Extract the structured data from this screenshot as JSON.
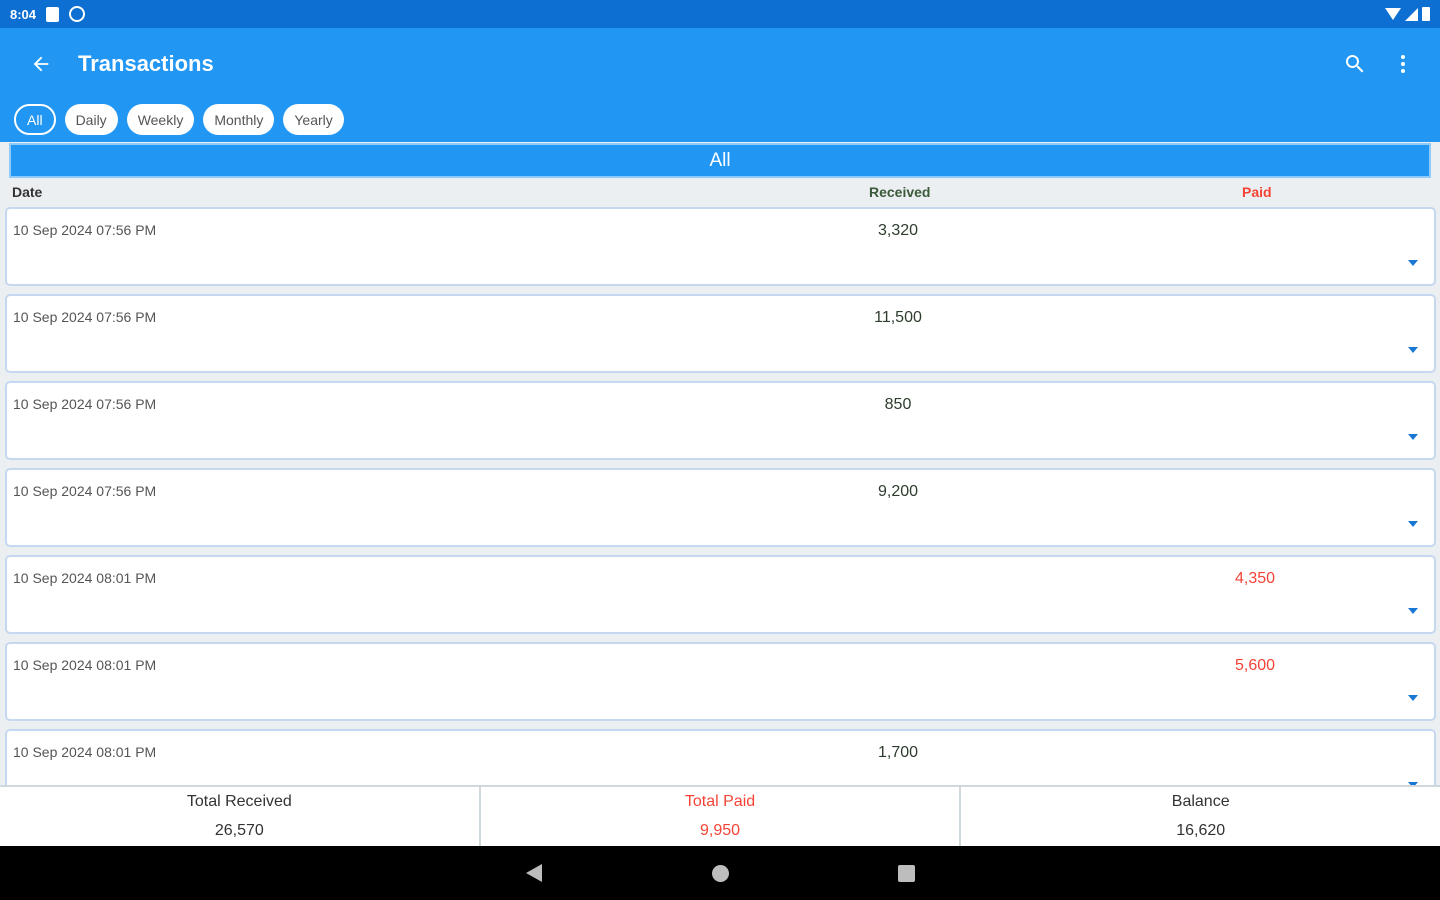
{
  "status_bar": {
    "time": "8:04"
  },
  "toolbar": {
    "title": "Transactions"
  },
  "filters": [
    {
      "label": "All",
      "active": true
    },
    {
      "label": "Daily",
      "active": false
    },
    {
      "label": "Weekly",
      "active": false
    },
    {
      "label": "Monthly",
      "active": false
    },
    {
      "label": "Yearly",
      "active": false
    }
  ],
  "period_label": "All",
  "columns": {
    "date": "Date",
    "received": "Received",
    "paid": "Paid"
  },
  "transactions": [
    {
      "date": "10 Sep 2024 07:56 PM",
      "received": "3,320",
      "paid": ""
    },
    {
      "date": "10 Sep 2024 07:56 PM",
      "received": "11,500",
      "paid": ""
    },
    {
      "date": "10 Sep 2024 07:56 PM",
      "received": "850",
      "paid": ""
    },
    {
      "date": "10 Sep 2024 07:56 PM",
      "received": "9,200",
      "paid": ""
    },
    {
      "date": "10 Sep 2024 08:01 PM",
      "received": "",
      "paid": "4,350"
    },
    {
      "date": "10 Sep 2024 08:01 PM",
      "received": "",
      "paid": "5,600"
    },
    {
      "date": "10 Sep 2024 08:01 PM",
      "received": "1,700",
      "paid": ""
    }
  ],
  "totals": {
    "received_label": "Total Received",
    "received_value": "26,570",
    "paid_label": "Total Paid",
    "paid_value": "9,950",
    "balance_label": "Balance",
    "balance_value": "16,620"
  },
  "colors": {
    "primary": "#2196f3",
    "status_bar": "#0d6fd1",
    "paid": "#f44336",
    "received": "#2e3d2e"
  },
  "icons": {
    "back": "arrow-left-icon",
    "search": "search-icon",
    "more": "more-vert-icon",
    "expand": "chevron-down-icon"
  }
}
